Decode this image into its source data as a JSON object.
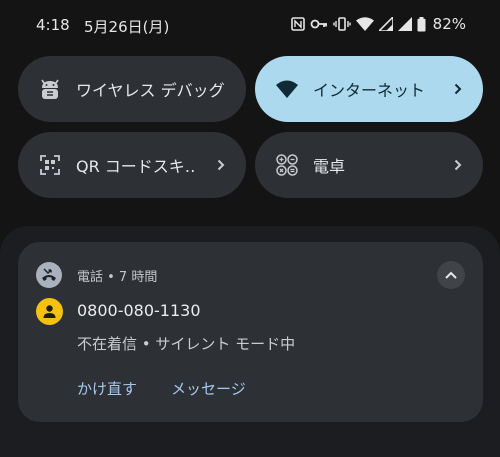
{
  "status_bar": {
    "time": "4:18",
    "date": "5月26日(月)",
    "battery": "82%",
    "icons": [
      "nfc-icon",
      "key-icon",
      "vibrate-icon",
      "wifi-icon",
      "signal-icon",
      "signal-icon",
      "battery-icon"
    ]
  },
  "quick_settings": {
    "tiles": [
      {
        "label": "ワイヤレス デバッグ",
        "icon": "android-debug-icon",
        "active": false
      },
      {
        "label": "インターネット",
        "icon": "wifi-icon",
        "active": true
      },
      {
        "label": "QR コードスキ‥",
        "icon": "qr-scan-icon",
        "active": false
      },
      {
        "label": "電卓",
        "icon": "calculator-icon",
        "active": false
      }
    ]
  },
  "notification": {
    "app_header": "電話 • 7 時間",
    "title": "0800-080-1130",
    "text": "不在着信 • サイレント モード中",
    "actions": [
      "かけ直す",
      "メッセージ"
    ],
    "icons": [
      "missed-call-icon",
      "contact-avatar-icon",
      "collapse-chevron-icon"
    ]
  },
  "colors": {
    "background": "#141414",
    "tile": "#2d3034",
    "tile_active": "#acd9ee",
    "shade": "#1b1d20",
    "action_text": "#a6c9f0",
    "avatar": "#f4c20d"
  }
}
